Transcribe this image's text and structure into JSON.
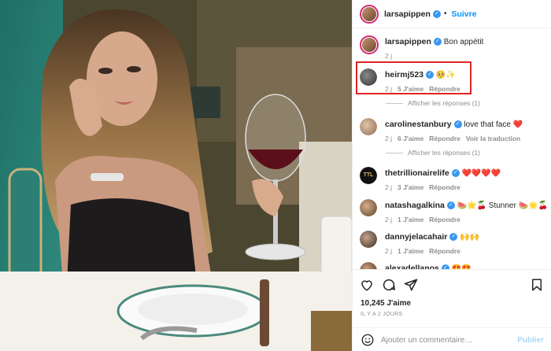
{
  "header": {
    "username": "larsapippen",
    "follow_label": "Suivre"
  },
  "caption": {
    "username": "larsapippen",
    "text": "Bon appétit",
    "time": "2 j"
  },
  "comments": [
    {
      "username": "heirmj523",
      "text": "🥺✨",
      "time": "2 j",
      "likes": "5 J'aime",
      "reply": "Répondre",
      "view_replies": "Afficher les réponses (1)"
    },
    {
      "username": "carolinestanbury",
      "text": "love that face ❤️",
      "time": "2 j",
      "likes": "6 J'aime",
      "reply": "Répondre",
      "translate": "Voir la traduction",
      "view_replies": "Afficher les réponses (1)"
    },
    {
      "username": "thetrillionairelife",
      "text": "❤️❤️❤️❤️",
      "time": "2 j",
      "likes": "3 J'aime",
      "reply": "Répondre"
    },
    {
      "username": "natashagalkina",
      "text": "🍉🌟🍒 Stunner 🍉🌟🍒",
      "time": "2 j",
      "likes": "1 J'aime",
      "reply": "Répondre"
    },
    {
      "username": "dannyjelacahair",
      "text": "🙌🙌",
      "time": "2 j",
      "likes": "1 J'aime",
      "reply": "Répondre"
    },
    {
      "username": "alexadellanos",
      "text": "😍😍"
    }
  ],
  "post": {
    "likes": "10,245 J'aime",
    "time_ago": "IL Y A 2 JOURS",
    "comment_placeholder": "Ajouter un commentaire…",
    "publish_label": "Publier"
  }
}
